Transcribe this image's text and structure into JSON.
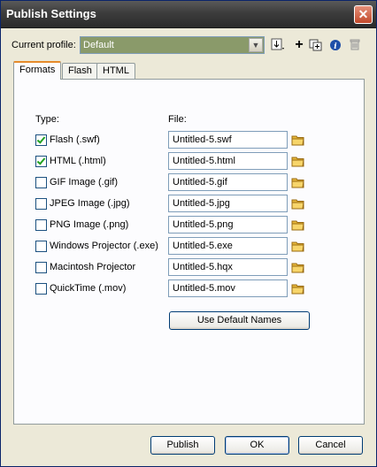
{
  "window": {
    "title": "Publish Settings",
    "close_glyph": "✕"
  },
  "profile": {
    "label": "Current profile:",
    "value": "Default"
  },
  "toolbar": [
    {
      "icon": "import-export-icon",
      "glyph": "⇓"
    },
    {
      "icon": "add-icon",
      "glyph": "+"
    },
    {
      "icon": "duplicate-icon",
      "glyph": "⧉"
    },
    {
      "icon": "info-icon",
      "glyph": "i"
    },
    {
      "icon": "delete-icon",
      "glyph": "🗑"
    }
  ],
  "tabs": [
    {
      "label": "Formats",
      "active": true
    },
    {
      "label": "Flash",
      "active": false
    },
    {
      "label": "HTML",
      "active": false
    }
  ],
  "headers": {
    "type": "Type:",
    "file": "File:"
  },
  "formats": [
    {
      "type": "Flash  (.swf)",
      "file": "Untitled-5.swf",
      "checked": true
    },
    {
      "type": "HTML  (.html)",
      "file": "Untitled-5.html",
      "checked": true
    },
    {
      "type": "GIF Image  (.gif)",
      "file": "Untitled-5.gif",
      "checked": false
    },
    {
      "type": "JPEG Image  (.jpg)",
      "file": "Untitled-5.jpg",
      "checked": false
    },
    {
      "type": "PNG Image  (.png)",
      "file": "Untitled-5.png",
      "checked": false
    },
    {
      "type": "Windows Projector  (.exe)",
      "file": "Untitled-5.exe",
      "checked": false
    },
    {
      "type": "Macintosh Projector",
      "file": "Untitled-5.hqx",
      "checked": false
    },
    {
      "type": "QuickTime  (.mov)",
      "file": "Untitled-5.mov",
      "checked": false
    }
  ],
  "use_default_names": "Use Default Names",
  "buttons": {
    "publish": "Publish",
    "ok": "OK",
    "cancel": "Cancel"
  },
  "colors": {
    "title_bar": "#3c3c3c",
    "tab_accent": "#e68b2c",
    "check": "#21a121"
  }
}
